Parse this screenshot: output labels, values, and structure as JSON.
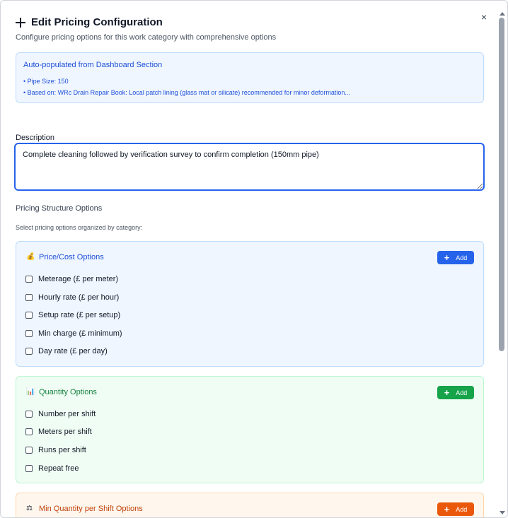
{
  "dialog": {
    "title": "Edit Pricing Configuration",
    "subtitle": "Configure pricing options for this work category with comprehensive options",
    "close_label": "×"
  },
  "info": {
    "title": "Auto-populated from Dashboard Section",
    "lines": [
      "• Pipe Size: 150",
      "• Based on: WRc Drain Repair Book: Local patch lining (glass mat or silicate) recommended for minor deformation..."
    ]
  },
  "description": {
    "label": "Description",
    "value": "Complete cleaning followed by verification survey to confirm completion (150mm pipe)"
  },
  "pricing": {
    "label": "Pricing Structure Options",
    "hint": "Select pricing options organized by category:"
  },
  "categories": [
    {
      "title": "Price/Cost Options",
      "icon": "money-bag-icon",
      "color": "#1d4ed8",
      "button_color": "#2563eb",
      "add_label": "Add",
      "options": [
        " Meterage (£ per meter)",
        " Hourly rate (£ per hour)",
        "Setup rate (£ per setup)",
        "Min charge (£ minimum)",
        "Day rate (£ per day)"
      ]
    },
    {
      "title": "Quantity Options",
      "icon": "bar-chart-icon",
      "color": "#15803d",
      "button_color": "#16a34a",
      "add_label": "Add",
      "options": [
        "Number per shift",
        "Meters per shift",
        "Runs per shift",
        "Repeat free"
      ]
    },
    {
      "title": "Min Quantity per Shift Options",
      "icon": "scale-icon",
      "color": "#c2410c",
      "button_color": "#ea580c",
      "add_label": "Add",
      "options": []
    }
  ]
}
